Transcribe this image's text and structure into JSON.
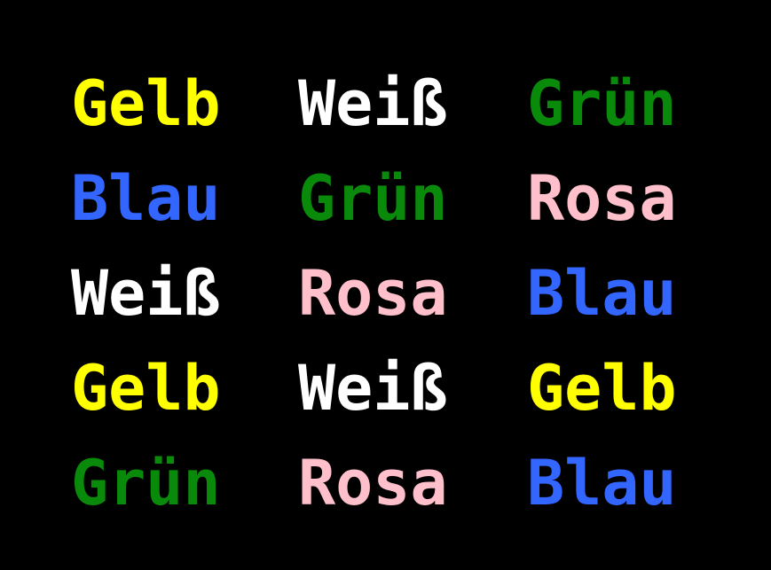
{
  "background": "#000000",
  "colors": {
    "yellow": "#ffff00",
    "white": "#ffffff",
    "green": "#0a8a0a",
    "blue": "#3366ff",
    "pink": "#ffc0cb"
  },
  "rows": [
    [
      {
        "text": "Gelb",
        "color": "#ffff00"
      },
      {
        "text": "Weiß",
        "color": "#ffffff"
      },
      {
        "text": "Grün",
        "color": "#0a8a0a"
      }
    ],
    [
      {
        "text": "Blau",
        "color": "#3366ff"
      },
      {
        "text": "Grün",
        "color": "#0a8a0a"
      },
      {
        "text": "Rosa",
        "color": "#ffc0cb"
      }
    ],
    [
      {
        "text": "Weiß",
        "color": "#ffffff"
      },
      {
        "text": "Rosa",
        "color": "#ffc0cb"
      },
      {
        "text": "Blau",
        "color": "#3366ff"
      }
    ],
    [
      {
        "text": "Gelb",
        "color": "#ffff00"
      },
      {
        "text": "Weiß",
        "color": "#ffffff"
      },
      {
        "text": "Gelb",
        "color": "#ffff00"
      }
    ],
    [
      {
        "text": "Grün",
        "color": "#0a8a0a"
      },
      {
        "text": "Rosa",
        "color": "#ffc0cb"
      },
      {
        "text": "Blau",
        "color": "#3366ff"
      }
    ]
  ]
}
